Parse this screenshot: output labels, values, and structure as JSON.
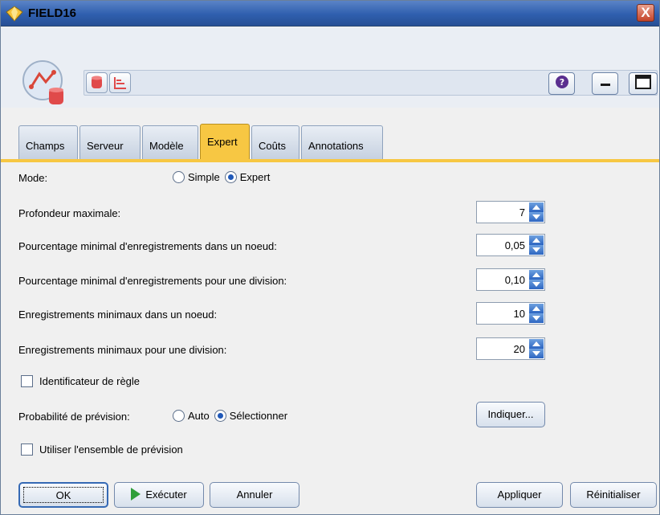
{
  "window": {
    "title": "FIELD16",
    "close_label": "X"
  },
  "header": {
    "icons": [
      "field-node-icon",
      "database-icon",
      "chart-icon"
    ],
    "right_buttons": [
      "help-icon",
      "minimize-icon",
      "maximize-icon"
    ]
  },
  "tabs": [
    {
      "label": "Champs",
      "active": false
    },
    {
      "label": "Serveur",
      "active": false
    },
    {
      "label": "Modèle",
      "active": false
    },
    {
      "label": "Expert",
      "active": true
    },
    {
      "label": "Coûts",
      "active": false
    },
    {
      "label": "Annotations",
      "active": false
    }
  ],
  "form": {
    "mode_label": "Mode:",
    "mode_options": {
      "simple": "Simple",
      "expert": "Expert",
      "selected": "Expert"
    },
    "max_depth": {
      "label": "Profondeur maximale:",
      "value": "7"
    },
    "min_pct_node": {
      "label": "Pourcentage minimal d'enregistrements dans un noeud:",
      "value": "0,05"
    },
    "min_pct_split": {
      "label": "Pourcentage minimal d'enregistrements pour une division:",
      "value": "0,10"
    },
    "min_rec_node": {
      "label": "Enregistrements minimaux dans un noeud:",
      "value": "10"
    },
    "min_rec_split": {
      "label": "Enregistrements minimaux pour une division:",
      "value": "20"
    },
    "rule_id": {
      "label": "Identificateur de règle",
      "checked": false
    },
    "pred_prob": {
      "label": "Probabilité de prévision:",
      "auto": "Auto",
      "select": "Sélectionner",
      "selected": "Sélectionner",
      "button": "Indiquer..."
    },
    "use_pred_set": {
      "label": "Utiliser l'ensemble de prévision",
      "checked": false
    }
  },
  "buttons": {
    "ok": "OK",
    "execute": "Exécuter",
    "cancel": "Annuler",
    "apply": "Appliquer",
    "reset": "Réinitialiser"
  },
  "colors": {
    "active_tab": "#f7c743",
    "spinner": "#2d66c1",
    "title_bar": "#2f5fae"
  }
}
